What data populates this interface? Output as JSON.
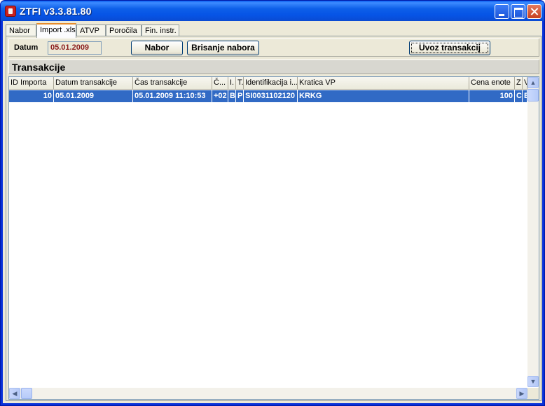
{
  "window": {
    "title": "ZTFI v3.3.81.80"
  },
  "tabs": [
    {
      "label": "Nabor"
    },
    {
      "label": "Import .xls"
    },
    {
      "label": "ATVP"
    },
    {
      "label": "Poročila"
    },
    {
      "label": "Fin. instr."
    }
  ],
  "active_tab": "Import .xls",
  "toolbar": {
    "datum_label": "Datum",
    "datum_value": "05.01.2009",
    "nabor_button": "Nabor",
    "brisanje_button": "Brisanje nabora",
    "uvoz_button": "Uvoz transakcij"
  },
  "section": {
    "title": "Transakcije"
  },
  "grid": {
    "columns": [
      "ID Importa",
      "Datum transakcije",
      "Čas transakcije",
      "Č...",
      "I.",
      "T.",
      "Identifikacija i...",
      "Kratica VP",
      "Cena enote",
      "Z",
      "V"
    ],
    "rows": [
      [
        "10",
        "05.01.2009",
        "05.01.2009 11:10:53",
        "+02",
        "B",
        "P",
        "SI0031102120",
        "KRKG",
        "100",
        "C",
        "E"
      ]
    ],
    "selected_row": 0
  },
  "colors": {
    "titlebar": "#0a5ff0",
    "selection": "#316ac5",
    "date_text": "#8b1d1d",
    "face": "#ece9d8"
  }
}
